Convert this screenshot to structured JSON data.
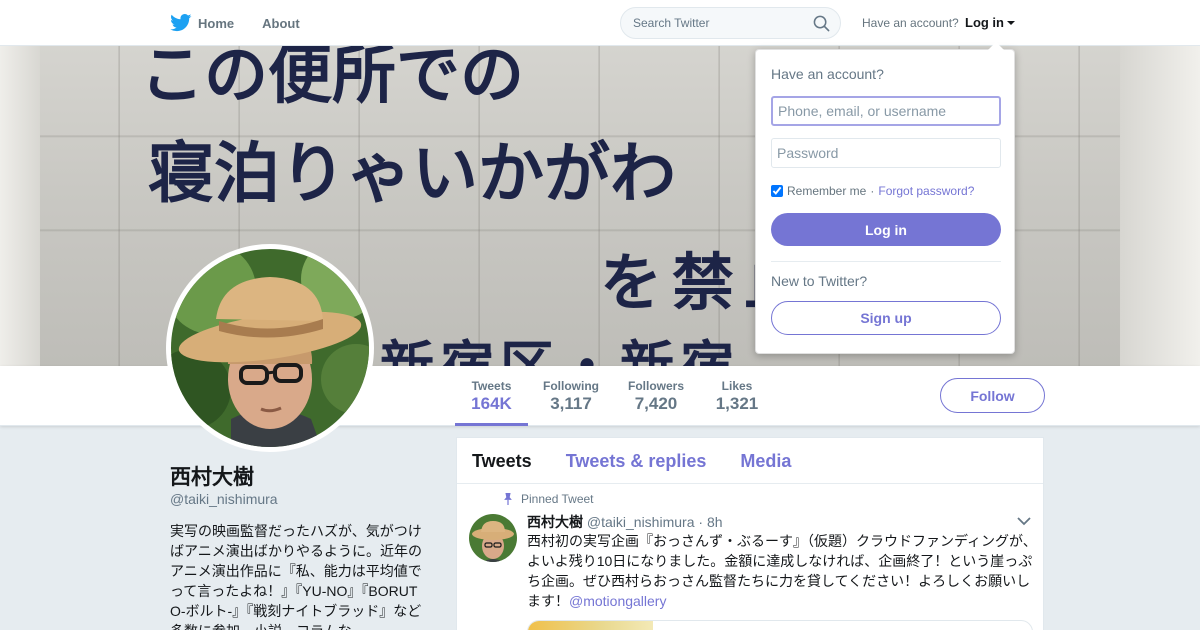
{
  "nav": {
    "home_label": "Home",
    "about_label": "About",
    "search_placeholder": "Search Twitter",
    "have_account": "Have an account?",
    "login_label": "Log in",
    "icons": {
      "logo": "twitter-bird-icon",
      "search": "search-icon",
      "caret": "caret-down-icon"
    }
  },
  "banner": {
    "sign_lines": [
      "この便所での",
      "寝泊りゃいかがわ",
      "を禁止",
      "新宿区・新宿"
    ]
  },
  "stats": [
    {
      "label": "Tweets",
      "value": "164K",
      "active": true
    },
    {
      "label": "Following",
      "value": "3,117",
      "active": false
    },
    {
      "label": "Followers",
      "value": "7,420",
      "active": false
    },
    {
      "label": "Likes",
      "value": "1,321",
      "active": false
    }
  ],
  "follow_label": "Follow",
  "profile": {
    "name": "西村大樹",
    "handle": "@taiki_nishimura",
    "bio": "実写の映画監督だったハズが、気がつけばアニメ演出ばかりやるように。近年のアニメ演出作品に『私、能力は平均値でって言ったよね！』『YU-NO』『BORUTO-ボルト-』『戦刻ナイトブラッド』など多数に参加。小説、コラムな"
  },
  "timeline": {
    "tabs": [
      "Tweets",
      "Tweets & replies",
      "Media"
    ],
    "pinned_label": "Pinned Tweet",
    "tweet": {
      "name": "西村大樹",
      "handle": "@taiki_nishimura",
      "separator": "·",
      "time": "8h",
      "text": "西村初の実写企画『おっさんず・ぶるーす』（仮題）クラウドファンディングが、よいよ残り10日になりました。金額に達成しなければ、企画終了！という崖っぷち企画。ぜひ西村らおっさん監督たちに力を貸してください！よろしくお願いします！",
      "mention": "@motiongallery"
    }
  },
  "login_dropdown": {
    "title": "Have an account?",
    "username_placeholder": "Phone, email, or username",
    "password_placeholder": "Password",
    "remember_label": "Remember me",
    "separator": "·",
    "forgot_label": "Forgot password?",
    "login_button": "Log in",
    "new_label": "New to Twitter?",
    "signup_button": "Sign up"
  },
  "colors": {
    "accent": "#7575d4",
    "muted": "#657786",
    "background": "#e6ecf0",
    "logo": "#1da1f2"
  }
}
